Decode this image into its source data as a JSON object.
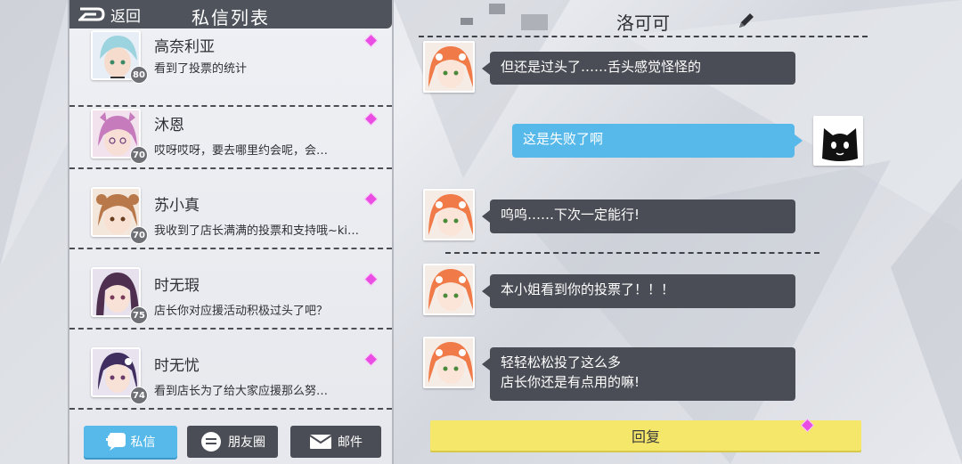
{
  "header": {
    "back_label": "返回",
    "title": "私信列表"
  },
  "contacts": [
    {
      "name": "高奈利亚",
      "preview": "看到了投票的统计",
      "level": "80",
      "avatar_icon": "avatar-blue-hair"
    },
    {
      "name": "沐恩",
      "preview": "哎呀哎呀，要去哪里约会呢，会…",
      "level": "70",
      "avatar_icon": "avatar-pink-hair"
    },
    {
      "name": "苏小真",
      "preview": "我收到了店长满满的投票和支持哦~ki…",
      "level": "70",
      "avatar_icon": "avatar-brown-hair"
    },
    {
      "name": "时无瑕",
      "preview": "店长你对应援活动积极过头了吧？",
      "level": "75",
      "avatar_icon": "avatar-purple-hair"
    },
    {
      "name": "时无忧",
      "preview": "看到店长为了给大家应援那么努…",
      "level": "74",
      "avatar_icon": "avatar-purple-hair-2"
    }
  ],
  "tabs": [
    {
      "label": "私信",
      "icon": "chat-bubble-icon"
    },
    {
      "label": "朋友圈",
      "icon": "moments-icon"
    },
    {
      "label": "邮件",
      "icon": "mail-icon"
    }
  ],
  "chat": {
    "title": "洛可可",
    "messages": [
      {
        "from": "them",
        "text": "但还是过头了……舌头感觉怪怪的"
      },
      {
        "from": "me",
        "text": "这是失败了啊"
      },
      {
        "from": "them",
        "text": "呜呜……下次一定能行!"
      },
      {
        "from": "them",
        "text": "本小姐看到你的投票了！！！"
      },
      {
        "from": "them",
        "line1": "轻轻松松投了这么多",
        "line2": "店长你还是有点用的嘛!"
      }
    ],
    "reply_label": "回复"
  },
  "colors": {
    "panel_header": "#4f535b",
    "accent_pink": "#e94de2",
    "tab_active": "#56b9ea",
    "tab_inactive": "#4a4d55",
    "reply_yellow": "#f5e76a",
    "bubble_dark": "#4a4d55",
    "bubble_blue": "#56b9ea"
  }
}
